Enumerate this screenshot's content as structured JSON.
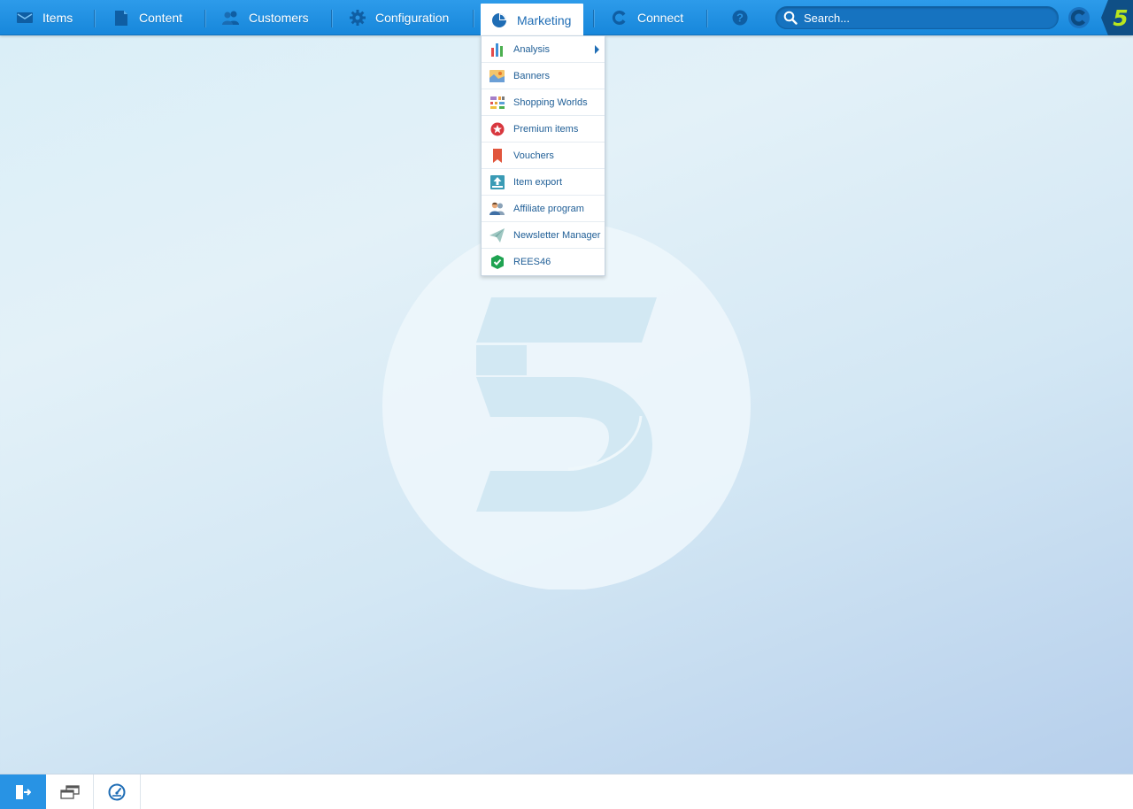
{
  "nav": {
    "items": [
      {
        "label": "Items",
        "icon": "items-icon"
      },
      {
        "label": "Content",
        "icon": "content-icon"
      },
      {
        "label": "Customers",
        "icon": "customers-icon"
      },
      {
        "label": "Configuration",
        "icon": "gear-icon"
      },
      {
        "label": "Marketing",
        "icon": "pie-chart-icon",
        "active": true
      },
      {
        "label": "Connect",
        "icon": "connect-icon"
      }
    ],
    "help_icon": "help-icon",
    "search_placeholder": "Search...",
    "brand_logo": "shopware-logo",
    "version_logo": "5"
  },
  "marketing_menu": {
    "items": [
      {
        "label": "Analysis",
        "icon": "bar-chart-icon",
        "has_submenu": true
      },
      {
        "label": "Banners",
        "icon": "image-icon"
      },
      {
        "label": "Shopping Worlds",
        "icon": "grid-icon"
      },
      {
        "label": "Premium items",
        "icon": "badge-icon"
      },
      {
        "label": "Vouchers",
        "icon": "bookmark-icon"
      },
      {
        "label": "Item export",
        "icon": "export-icon"
      },
      {
        "label": "Affiliate program",
        "icon": "users-icon"
      },
      {
        "label": "Newsletter Manager",
        "icon": "paper-plane-icon"
      },
      {
        "label": "REES46",
        "icon": "shield-icon"
      }
    ]
  },
  "footer": {
    "buttons": [
      {
        "name": "logout",
        "icon": "logout-icon"
      },
      {
        "name": "windows",
        "icon": "windows-icon"
      },
      {
        "name": "dashboard",
        "icon": "speedometer-icon"
      }
    ]
  },
  "colors": {
    "nav_bg": "#2d9bea",
    "accent": "#1f6db5",
    "menu_text": "#1f5e96",
    "brand_green": "#b9e61e"
  }
}
